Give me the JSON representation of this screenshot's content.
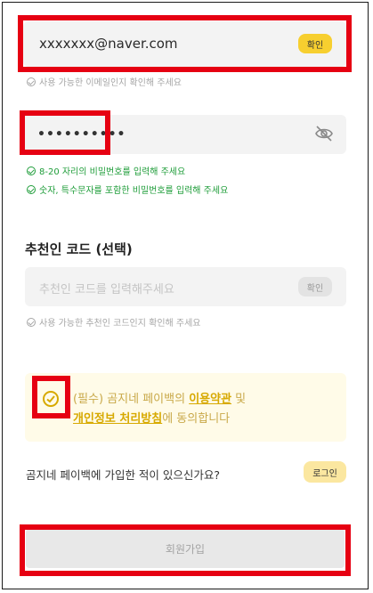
{
  "email": {
    "value": "xxxxxxx@naver.com",
    "confirm_label": "확인",
    "hint": "사용 가능한 이메일인지 확인해 주세요"
  },
  "password": {
    "value": "••••••••••",
    "hints": [
      "8-20 자리의 비밀번호를 입력해 주세요",
      "숫자, 특수문자를 포함한 비밀번호를 입력해 주세요"
    ]
  },
  "referral": {
    "title": "추천인 코드 (선택)",
    "placeholder": "추천인 코드를 입력해주세요",
    "confirm_label": "확인",
    "hint": "사용 가능한 추천인 코드인지 확인해 주세요"
  },
  "agreement": {
    "prefix": "(필수) 곰지네 페이백의 ",
    "terms_link": "이용약관",
    "middle": " 및",
    "privacy_link": "개인정보 처리방침",
    "suffix": "에 동의합니다"
  },
  "login_prompt": {
    "question": "곰지네 페이백에 가입한 적이 있으신가요?",
    "login_label": "로그인"
  },
  "signup": {
    "label": "회원가입"
  },
  "colors": {
    "highlight": "#e60012",
    "accent_yellow": "#f7cf2f",
    "valid_green": "#1f9d3a"
  }
}
